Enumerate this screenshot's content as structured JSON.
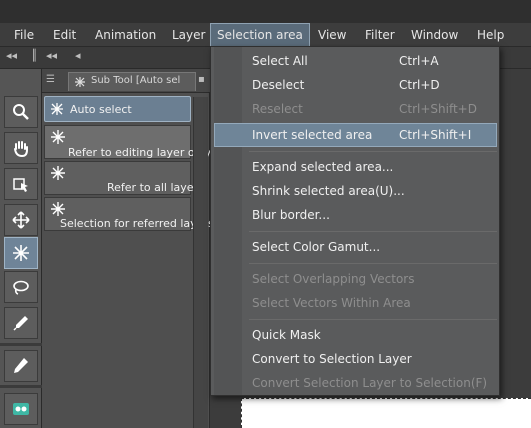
{
  "menubar": {
    "items": [
      "File",
      "Edit",
      "Animation",
      "Layer",
      "Selection area",
      "View",
      "Filter",
      "Window",
      "Help"
    ],
    "active": "Selection area"
  },
  "subtool_panel": {
    "tab_label": "Sub Tool [Auto sel",
    "top_item": "Auto select",
    "items": [
      "Refer to editing layer only",
      "Refer to all layers",
      "Selection for referred layers"
    ]
  },
  "tools": [
    "zoom-icon",
    "hand-icon",
    "object-icon",
    "move-icon",
    "auto-select-icon",
    "lasso-icon",
    "eyedropper-icon",
    "pen-icon",
    "layer-icon"
  ],
  "selection_menu": {
    "groups": [
      [
        {
          "label": "Select All",
          "shortcut": "Ctrl+A",
          "disabled": false
        },
        {
          "label": "Deselect",
          "shortcut": "Ctrl+D",
          "disabled": false
        },
        {
          "label": "Reselect",
          "shortcut": "Ctrl+Shift+D",
          "disabled": true
        },
        {
          "label": "Invert selected area",
          "shortcut": "Ctrl+Shift+I",
          "disabled": false,
          "highlighted": true
        }
      ],
      [
        {
          "label": "Expand selected area...",
          "shortcut": "",
          "disabled": false
        },
        {
          "label": "Shrink selected area(U)...",
          "shortcut": "",
          "disabled": false
        },
        {
          "label": "Blur border...",
          "shortcut": "",
          "disabled": false
        }
      ],
      [
        {
          "label": "Select Color Gamut...",
          "shortcut": "",
          "disabled": false
        }
      ],
      [
        {
          "label": "Select Overlapping Vectors",
          "shortcut": "",
          "disabled": true
        },
        {
          "label": "Select Vectors Within Area",
          "shortcut": "",
          "disabled": true
        }
      ],
      [
        {
          "label": "Quick Mask",
          "shortcut": "",
          "disabled": false
        },
        {
          "label": "Convert to Selection Layer",
          "shortcut": "",
          "disabled": false
        },
        {
          "label": "Convert Selection Layer to Selection(F)",
          "shortcut": "",
          "disabled": true
        }
      ]
    ]
  },
  "colors": {
    "highlight": "#6f8598",
    "active_menu": "#5a6b7a",
    "disabled_text": "#8e8e8e"
  }
}
